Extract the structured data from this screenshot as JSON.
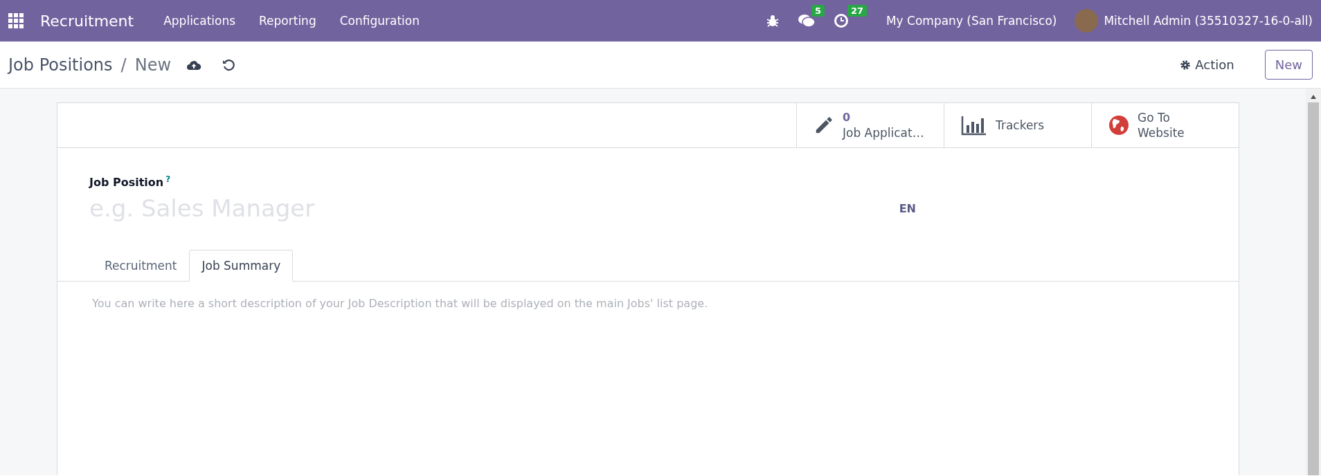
{
  "navbar": {
    "app_name": "Recruitment",
    "menu": [
      "Applications",
      "Reporting",
      "Configuration"
    ],
    "messages_count": "5",
    "activities_count": "27",
    "company": "My Company (San Francisco)",
    "user": "Mitchell Admin (35510327-16-0-all)"
  },
  "breadcrumb": {
    "parent": "Job Positions",
    "separator": "/",
    "current": "New"
  },
  "actions": {
    "action_label": "Action",
    "new_label": "New"
  },
  "stat_buttons": [
    {
      "kind": "count",
      "value": "0",
      "lines": [
        "Job Applicat…"
      ]
    },
    {
      "kind": "chart",
      "lines": [
        "Trackers"
      ]
    },
    {
      "kind": "globe",
      "lines": [
        "Go To",
        "Website"
      ]
    }
  ],
  "form": {
    "field_label": "Job Position",
    "help_mark": "?",
    "placeholder": "e.g. Sales Manager",
    "language": "EN"
  },
  "tabs": [
    {
      "label": "Recruitment",
      "selected": false
    },
    {
      "label": "Job Summary",
      "selected": true
    }
  ],
  "description": {
    "placeholder": "You can write here a short description of your Job Description that will be displayed on the main Jobs' list page."
  }
}
